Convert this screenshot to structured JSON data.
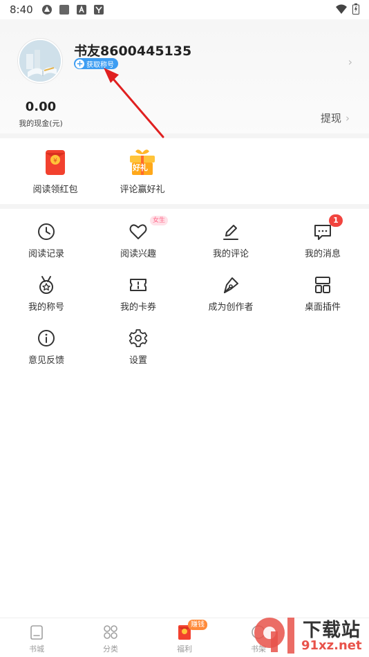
{
  "status_bar": {
    "time": "8:40"
  },
  "profile": {
    "username": "书友8600445135",
    "title_badge_label": "获取称号",
    "cash_value": "0.00",
    "cash_label": "我的现金(元)",
    "withdraw_label": "提现"
  },
  "promo": [
    {
      "label": "阅读领红包",
      "icon": "red-envelope-icon"
    },
    {
      "label": "评论赢好礼",
      "icon": "gift-box-icon",
      "icon_text": "好礼"
    }
  ],
  "menu": [
    {
      "label": "阅读记录",
      "icon": "clock-icon"
    },
    {
      "label": "阅读兴趣",
      "icon": "heart-icon",
      "tag": "女生"
    },
    {
      "label": "我的评论",
      "icon": "pencil-icon"
    },
    {
      "label": "我的消息",
      "icon": "message-icon",
      "badge": "1"
    },
    {
      "label": "我的称号",
      "icon": "medal-icon"
    },
    {
      "label": "我的卡券",
      "icon": "coupon-icon"
    },
    {
      "label": "成为创作者",
      "icon": "pen-nib-icon"
    },
    {
      "label": "桌面插件",
      "icon": "widget-icon"
    },
    {
      "label": "意见反馈",
      "icon": "info-icon"
    },
    {
      "label": "设置",
      "icon": "gear-icon"
    }
  ],
  "tabs": [
    {
      "label": "书城",
      "icon": "home-icon"
    },
    {
      "label": "分类",
      "icon": "category-icon"
    },
    {
      "label": "福利",
      "icon": "red-envelope-icon",
      "badge": "赚钱"
    },
    {
      "label": "书架",
      "icon": "bookshelf-icon"
    }
  ],
  "watermark": {
    "text_main": "下载站",
    "text_site": "91xz.net"
  },
  "colors": {
    "accent_blue": "#3d9df2",
    "badge_red": "#f1443f",
    "annotation_arrow": "#e02020"
  }
}
